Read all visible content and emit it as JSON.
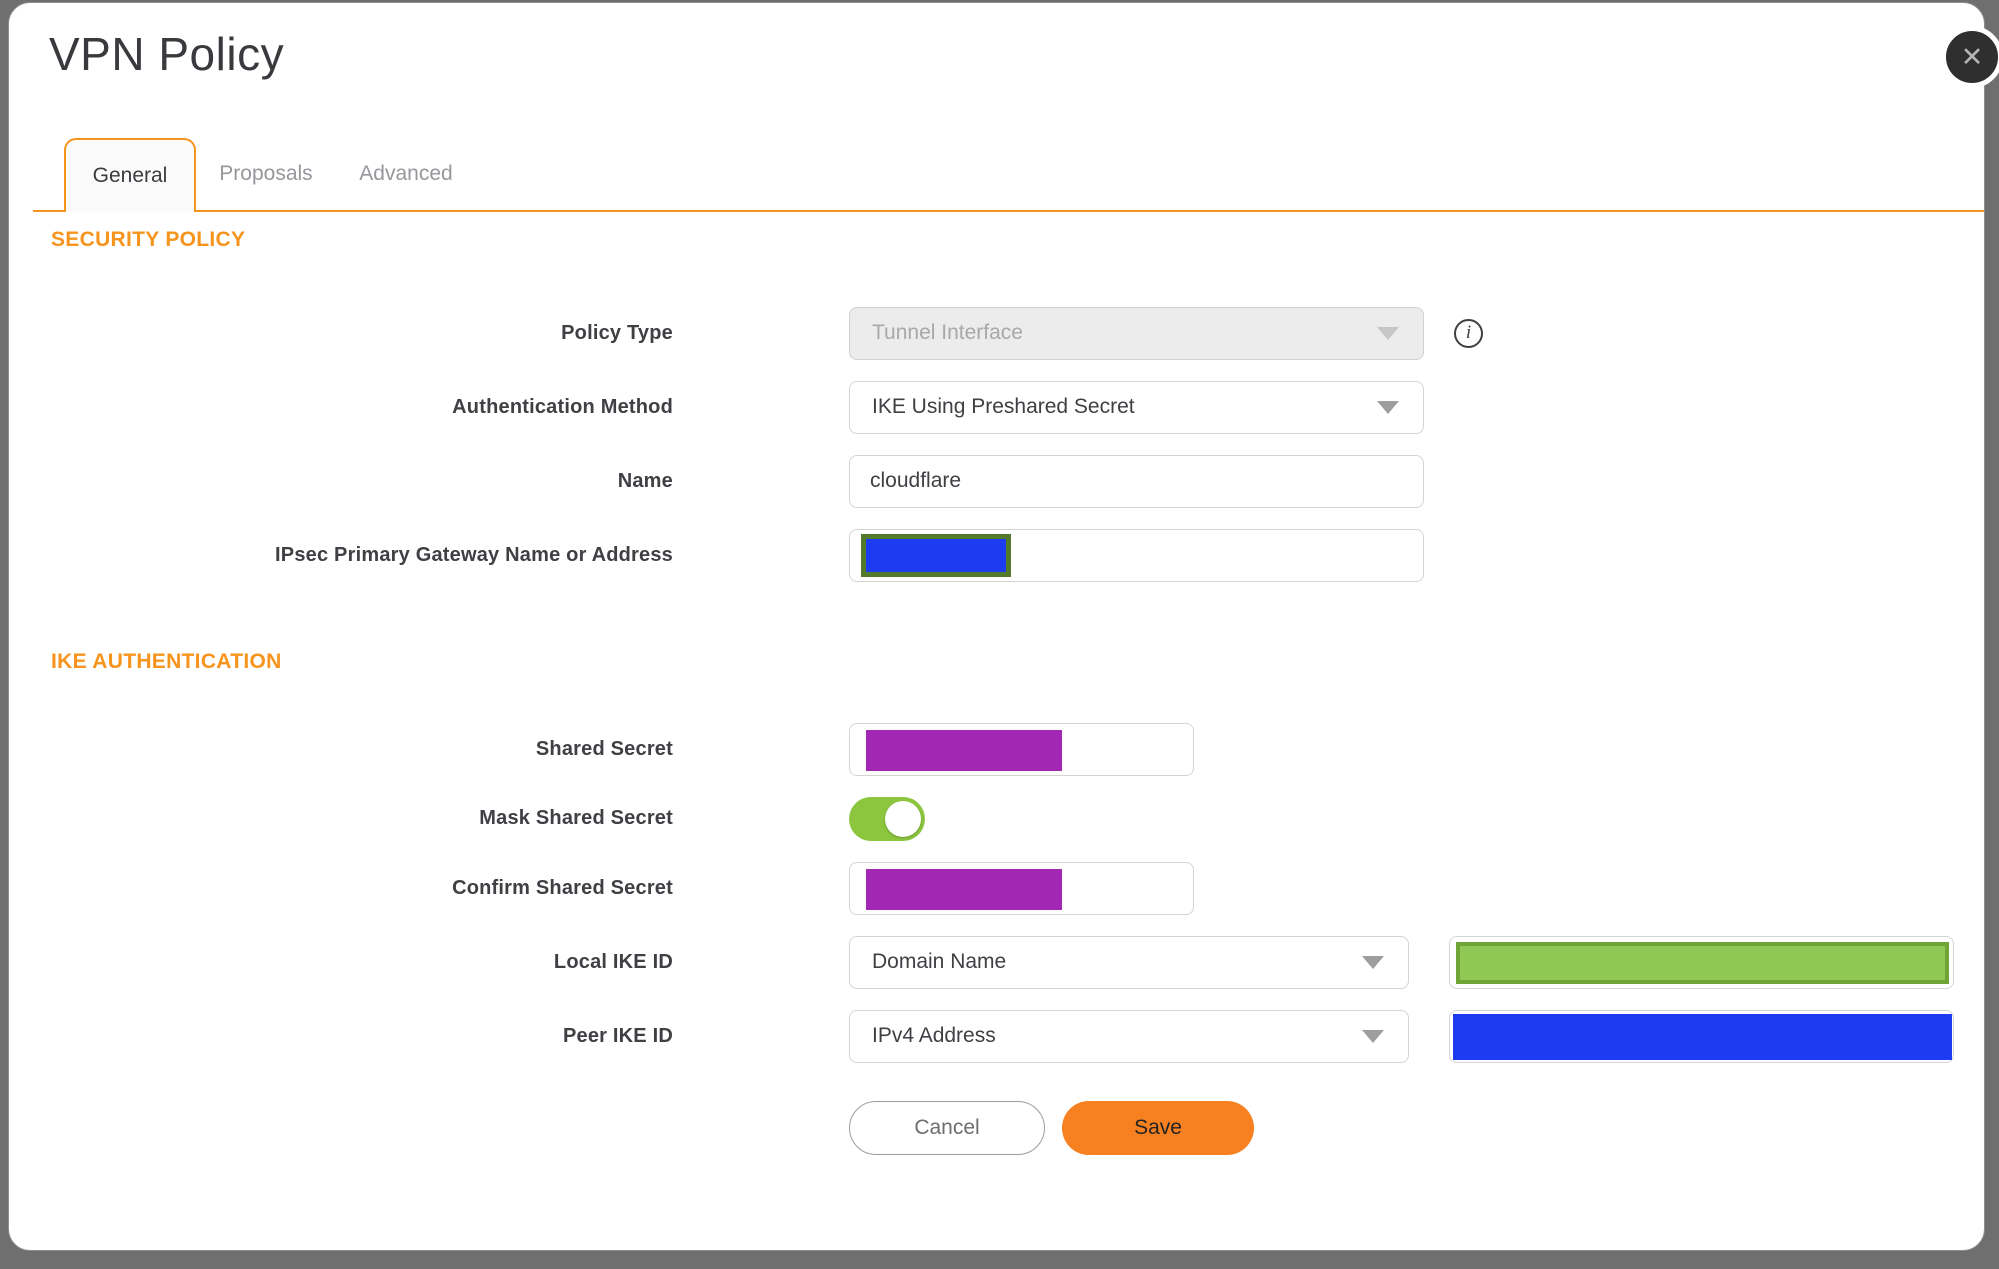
{
  "dialog": {
    "title": "VPN Policy",
    "tabs": [
      {
        "label": "General",
        "active": true
      },
      {
        "label": "Proposals",
        "active": false
      },
      {
        "label": "Advanced",
        "active": false
      }
    ],
    "security_policy": {
      "heading": "SECURITY POLICY",
      "policy_type": {
        "label": "Policy Type",
        "value": "Tunnel Interface",
        "disabled": true
      },
      "auth_method": {
        "label": "Authentication Method",
        "value": "IKE Using Preshared Secret"
      },
      "name": {
        "label": "Name",
        "value": "cloudflare"
      },
      "gateway": {
        "label": "IPsec Primary Gateway Name or Address",
        "value_redacted": true
      }
    },
    "ike_authentication": {
      "heading": "IKE AUTHENTICATION",
      "shared_secret": {
        "label": "Shared Secret",
        "value_redacted": true
      },
      "mask_shared_secret": {
        "label": "Mask Shared Secret",
        "enabled": true
      },
      "confirm_shared_secret": {
        "label": "Confirm Shared Secret",
        "value_redacted": true
      },
      "local_ike_id": {
        "label": "Local IKE ID",
        "value": "Domain Name",
        "extra_value_redacted": true
      },
      "peer_ike_id": {
        "label": "Peer IKE ID",
        "value": "IPv4 Address",
        "extra_value_redacted": true
      }
    },
    "actions": {
      "cancel": "Cancel",
      "save": "Save"
    }
  },
  "icons": {
    "close": "✕",
    "info": "i"
  },
  "colors": {
    "accent_orange": "#f7941e",
    "save_orange": "#f78121",
    "toggle_green": "#8cc63f",
    "redaction_blue": "#1d3bf0",
    "redaction_purple": "#a227b2",
    "redaction_green_fill": "#8fc855",
    "redaction_green_border": "#6fa536",
    "redaction_olive_border": "#53792a",
    "backdrop_gray": "#6f6f6f"
  }
}
